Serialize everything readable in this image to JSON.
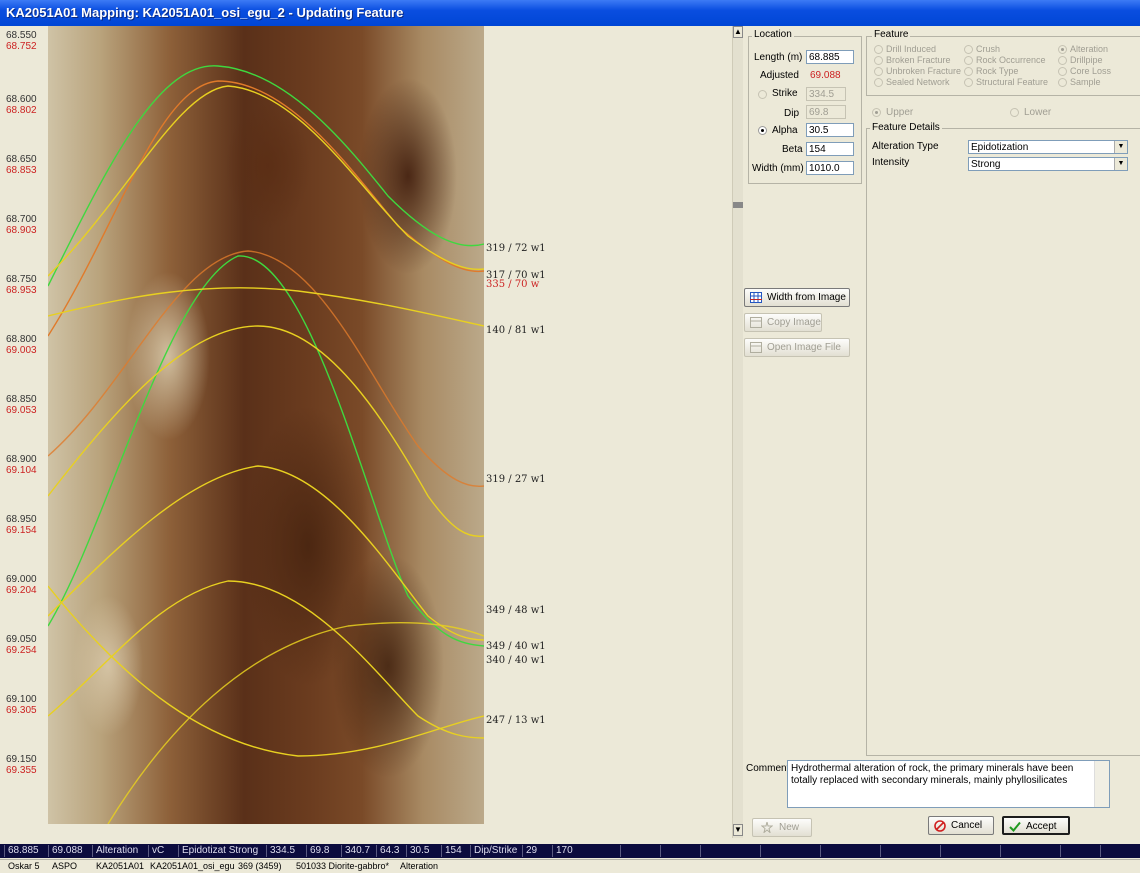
{
  "window": {
    "title": "KA2051A01 Mapping: KA2051A01_osi_egu_2 - Updating Feature"
  },
  "depth_scale": [
    {
      "d": "68.550",
      "adj": "68.752"
    },
    {
      "d": "68.600",
      "adj": "68.802"
    },
    {
      "d": "68.650",
      "adj": "68.853"
    },
    {
      "d": "68.700",
      "adj": "68.903"
    },
    {
      "d": "68.750",
      "adj": "68.953"
    },
    {
      "d": "68.800",
      "adj": "69.003"
    },
    {
      "d": "68.850",
      "adj": "69.053"
    },
    {
      "d": "68.900",
      "adj": "69.104"
    },
    {
      "d": "68.950",
      "adj": "69.154"
    },
    {
      "d": "69.000",
      "adj": "69.204"
    },
    {
      "d": "69.050",
      "adj": "69.254"
    },
    {
      "d": "69.100",
      "adj": "69.305"
    },
    {
      "d": "69.150",
      "adj": "69.355"
    }
  ],
  "feature_labels": [
    {
      "text": "319 / 72 w1",
      "color": "#222222"
    },
    {
      "text": "317 / 70 w1",
      "color": "#222222"
    },
    {
      "text": "335 / 70 w",
      "color": "#cc2222"
    },
    {
      "text": "140 / 81 w1",
      "color": "#222222"
    },
    {
      "text": "319 / 27 w1",
      "color": "#222222"
    },
    {
      "text": "349 / 48 w1",
      "color": "#222222"
    },
    {
      "text": "349 / 40 w1",
      "color": "#222222"
    },
    {
      "text": "340 / 40 w1",
      "color": "#222222"
    },
    {
      "text": "247 / 13 w1",
      "color": "#222222"
    }
  ],
  "location": {
    "group_label": "Location",
    "length_label": "Length (m)",
    "length_value": "68.885",
    "adjusted_label": "Adjusted",
    "adjusted_value": "69.088",
    "strike_label": "Strike",
    "strike_value": "334.5",
    "dip_label": "Dip",
    "dip_value": "69.8",
    "alpha_label": "Alpha",
    "alpha_value": "30.5",
    "beta_label": "Beta",
    "beta_value": "154",
    "width_label": "Width (mm)",
    "width_value": "1010.0"
  },
  "feature": {
    "group_label": "Feature",
    "options": [
      "Drill Induced",
      "Crush",
      "Alteration",
      "Broken Fracture",
      "Rock Occurrence",
      "Drillpipe",
      "Unbroken Fracture",
      "Rock Type",
      "Core Loss",
      "Sealed Network",
      "Structural Feature",
      "Sample"
    ],
    "selected": "Alteration",
    "upper_label": "Upper",
    "lower_label": "Lower"
  },
  "feature_details": {
    "group_label": "Feature Details",
    "alteration_type_label": "Alteration Type",
    "alteration_type_value": "Epidotization",
    "intensity_label": "Intensity",
    "intensity_value": "Strong"
  },
  "buttons": {
    "width_from_image": "Width from Image",
    "copy_image": "Copy Image",
    "open_image_file": "Open Image File",
    "new": "New",
    "cancel": "Cancel",
    "accept": "Accept"
  },
  "comment": {
    "label": "Comment",
    "text": "Hydrothermal alteration of rock, the primary minerals have been totally replaced with secondary minerals, mainly phyllosilicates"
  },
  "status_bar": [
    "68.885",
    "69.088",
    "Alteration",
    "vC",
    "Epidotizat Strong",
    "334.5",
    "69.8",
    "340.7",
    "64.3",
    "30.5",
    "154",
    "Dip/Strike",
    "29",
    "170"
  ],
  "info_bar": [
    "Oskar 5",
    "ASPO",
    "KA2051A01",
    "KA2051A01_osi_egu",
    "369 (3459)",
    "501033 Diorite-gabbro*",
    "Alteration"
  ],
  "colors": {
    "title_bar": "#0a4ee0",
    "adjusted_depth": "#cc2222",
    "trace_yellow": "#e8d020",
    "trace_green": "#3fd83f",
    "trace_orange": "#e07a2a",
    "status_bar_bg": "#0c0c3e"
  }
}
